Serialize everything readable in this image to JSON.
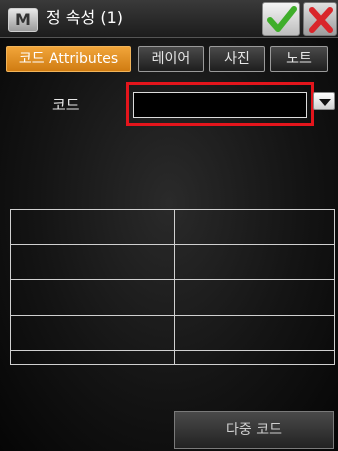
{
  "titlebar": {
    "app_icon_letter": "M",
    "title": "정 속성 (1)",
    "ok_icon": "checkmark-icon",
    "close_icon": "close-x-icon"
  },
  "tabs": [
    {
      "label": "코드 Attributes",
      "active": true
    },
    {
      "label": "레이어",
      "active": false
    },
    {
      "label": "사진",
      "active": false
    },
    {
      "label": "노트",
      "active": false
    }
  ],
  "code_field": {
    "label": "코드",
    "value": "",
    "dropdown_icon": "chevron-down-icon"
  },
  "attributes_table": {
    "rows": [
      [
        "",
        ""
      ],
      [
        "",
        ""
      ],
      [
        "",
        ""
      ],
      [
        "",
        ""
      ],
      [
        "",
        ""
      ]
    ]
  },
  "multi_code_button": {
    "label": "다중 코드"
  },
  "colors": {
    "active_tab": "#e08f22",
    "highlight": "#e4151c",
    "ok_check": "#3fae2a",
    "close_x": "#d9262b"
  }
}
